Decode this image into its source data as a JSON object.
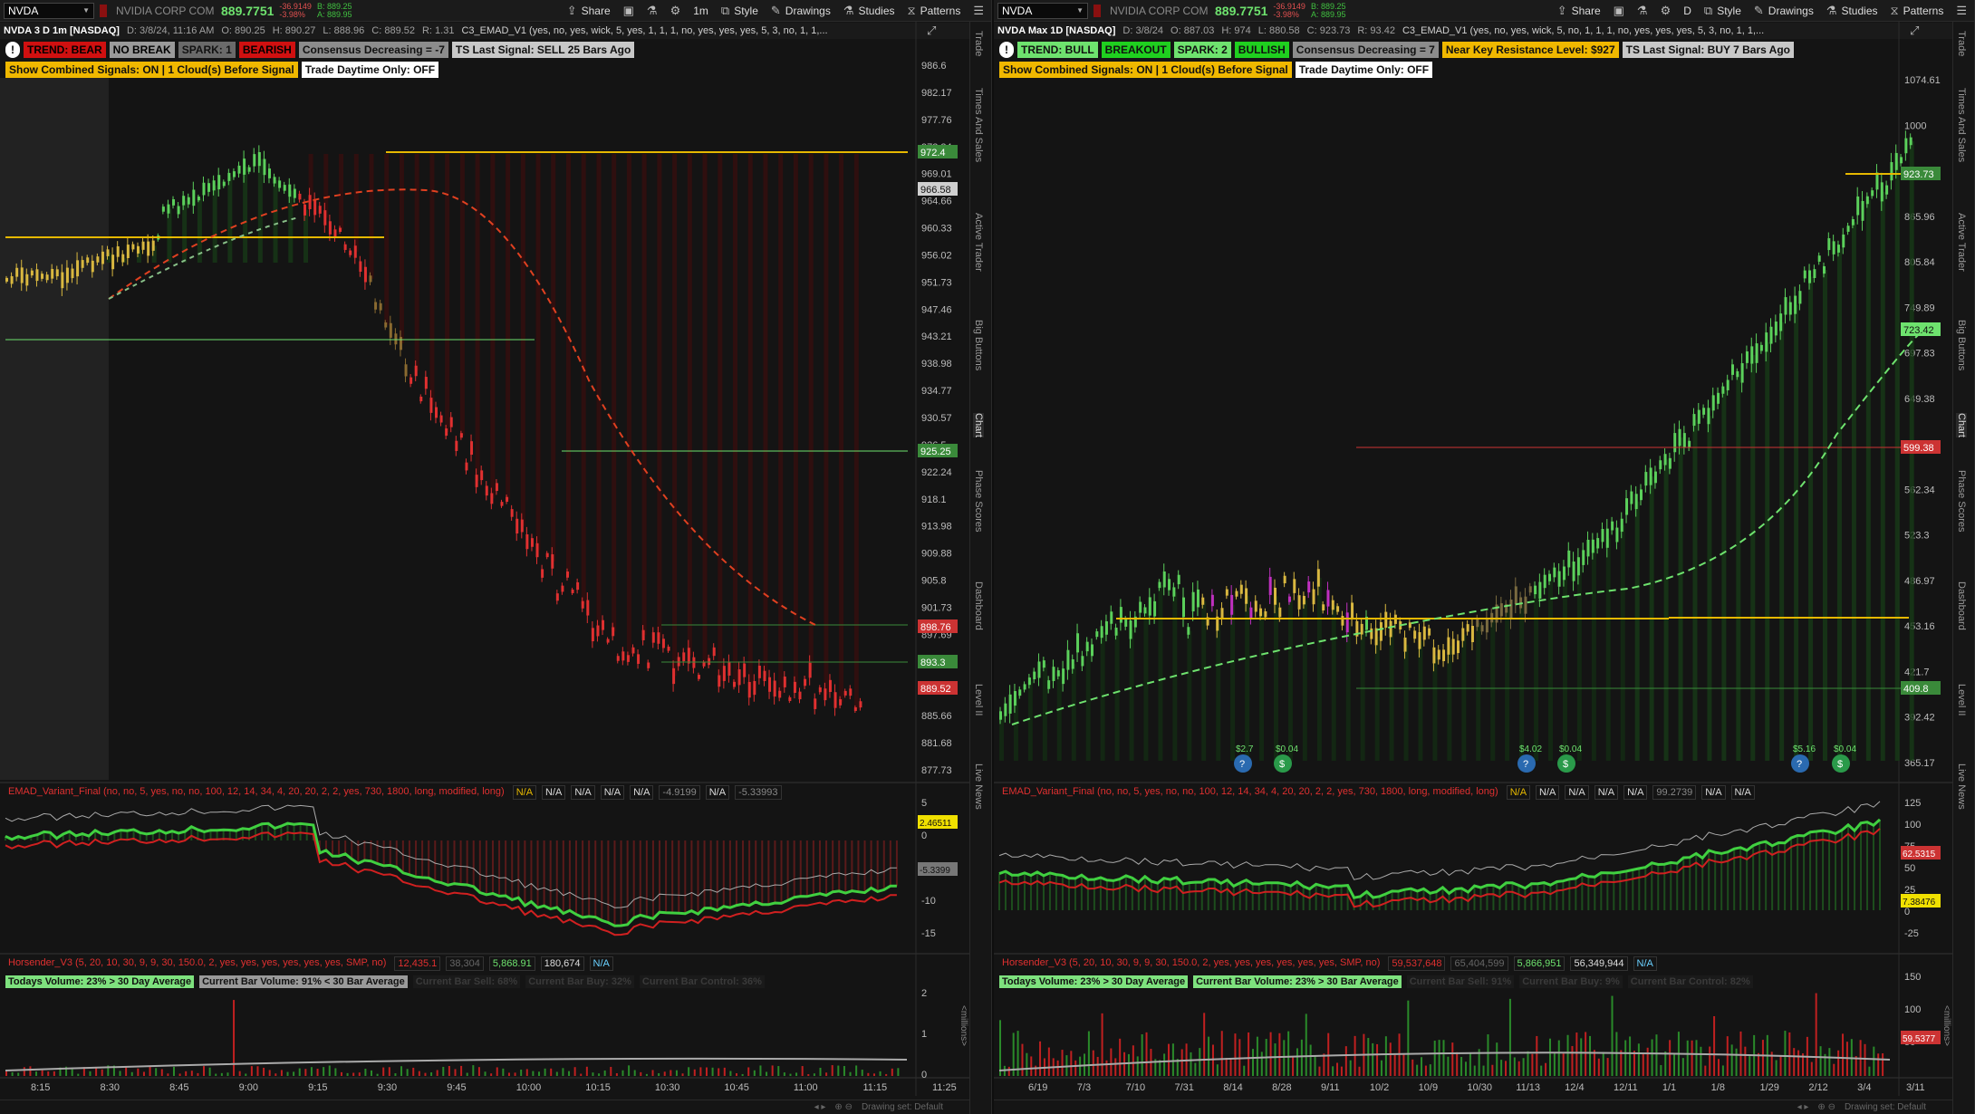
{
  "left": {
    "symbol": "NVDA",
    "company": "NVIDIA CORP COM",
    "price": "889.7751",
    "change_top": "-36.9149",
    "change_pct": "-3.98%",
    "bid": "B: 889.25",
    "ask": "A: 889.95",
    "toolbar": {
      "share": "Share",
      "period": "1m",
      "style": "Style",
      "drawings": "Drawings",
      "studies": "Studies",
      "patterns": "Patterns"
    },
    "header": {
      "title": "NVDA 3 D 1m [NASDAQ]",
      "date": "D: 3/8/24, 11:16 AM",
      "open": "O: 890.25",
      "high": "H: 890.27",
      "low": "L: 888.96",
      "close": "C: 889.52",
      "range": "R: 1.31",
      "study": "C3_EMAD_V1 (yes, no, yes, wick, 5, yes, 1, 1, 1, no, yes, yes, yes, 5, 3, no, 1, 1,..."
    },
    "labels": [
      {
        "text": "TREND: BEAR",
        "bg": "#d01010",
        "fg": "#000000"
      },
      {
        "text": "NO BREAK",
        "bg": "#9a9a9a",
        "fg": "#000000"
      },
      {
        "text": "SPARK: 1",
        "bg": "#6a6a6a",
        "fg": "#111111"
      },
      {
        "text": "BEARISH",
        "bg": "#d01010",
        "fg": "#000000"
      },
      {
        "text": "Consensus Decreasing = -7",
        "bg": "#8c8c8c",
        "fg": "#111111"
      },
      {
        "text": "TS Last Signal: SELL 25 Bars Ago",
        "bg": "#c8c8c8",
        "fg": "#111111"
      },
      {
        "text": "Show Combined Signals: ON | 1 Cloud(s) Before Signal",
        "bg": "#f0b800",
        "fg": "#111111"
      },
      {
        "text": "Trade Daytime Only: OFF",
        "bg": "#ffffff",
        "fg": "#111111"
      }
    ],
    "price_axis": [
      "986.6",
      "982.17",
      "977.76",
      "973.34",
      "969.01",
      "964.66",
      "960.33",
      "956.02",
      "951.73",
      "947.46",
      "943.21",
      "938.98",
      "934.77",
      "930.57",
      "926.5",
      "922.24",
      "918.1",
      "913.98",
      "909.88",
      "905.8",
      "901.73",
      "897.69",
      "893.3",
      "889.66",
      "885.66",
      "881.68",
      "877.73"
    ],
    "price_tags": [
      {
        "text": "972.4",
        "bg": "#3a8a3a"
      },
      {
        "text": "966.58",
        "bg": "#cfcfcf"
      },
      {
        "text": "925.25",
        "bg": "#3a8a3a"
      },
      {
        "text": "898.76",
        "bg": "#c33"
      },
      {
        "text": "893.3",
        "bg": "#3a8a3a"
      },
      {
        "text": "889.52",
        "bg": "#c33"
      }
    ],
    "ind1": {
      "name": "EMAD_Variant_Final (no, no, 5, yes, no, no, 100, 12, 14, 34, 4, 20, 20, 2, 2, yes, 730, 1800, long, modified, long)",
      "vals": [
        "N/A",
        "N/A",
        "N/A",
        "N/A",
        "N/A",
        "-4.9199",
        "N/A",
        "-5.33993"
      ],
      "axis": [
        "5",
        "0",
        "-5",
        "-10",
        "-15"
      ],
      "tag1": "2.46511",
      "tag2": "-5.3399"
    },
    "ind2": {
      "name": "Horsender_V3 (5, 20, 10, 30, 9, 9, 30, 150.0, 2, yes, yes, yes, yes, yes, yes, SMP, no)",
      "vals": [
        "12,435.1",
        "38,304",
        "5,868.91",
        "180,674",
        "N/A"
      ],
      "axis": [
        "2",
        "1",
        "0"
      ],
      "unit": "<millions>"
    },
    "vol_labels": [
      "Todays Volume: 23% > 30 Day Average",
      "Current Bar Volume: 91% < 30 Bar Average",
      "Current Bar Sell: 68%",
      "Current Bar Buy: 32%",
      "Current Bar Control: 36%"
    ],
    "time_axis": [
      "8:15",
      "8:30",
      "8:45",
      "9:00",
      "9:15",
      "9:30",
      "9:45",
      "10:00",
      "10:15",
      "10:30",
      "10:45",
      "11:00",
      "11:15",
      "11:25"
    ],
    "sidebar": [
      "Trade",
      "Times And Sales",
      "Active Trader",
      "Big Buttons",
      "Chart",
      "Phase Scores",
      "Dashboard",
      "Level II",
      "Live News"
    ],
    "drawing_set": "Drawing set: Default"
  },
  "right": {
    "symbol": "NVDA",
    "company": "NVIDIA CORP COM",
    "price": "889.7751",
    "change_top": "-36.9149",
    "change_pct": "-3.98%",
    "bid": "B: 889.25",
    "ask": "A: 889.95",
    "toolbar": {
      "share": "Share",
      "period": "D",
      "style": "Style",
      "drawings": "Drawings",
      "studies": "Studies",
      "patterns": "Patterns"
    },
    "header": {
      "title": "NVDA Max 1D [NASDAQ]",
      "date": "D: 3/8/24",
      "open": "O: 887.03",
      "high": "H: 974",
      "low": "L: 880.58",
      "close": "C: 923.73",
      "range": "R: 93.42",
      "study": "C3_EMAD_V1 (yes, no, yes, wick, 5, no, 1, 1, 1, no, yes, yes, yes, 5, 3, no, 1, 1,..."
    },
    "labels": [
      {
        "text": "TREND: BULL",
        "bg": "#6ee26e",
        "fg": "#111111"
      },
      {
        "text": "BREAKOUT",
        "bg": "#1fd01f",
        "fg": "#111111"
      },
      {
        "text": "SPARK: 2",
        "bg": "#6ee26e",
        "fg": "#111111"
      },
      {
        "text": "BULLISH",
        "bg": "#1fd01f",
        "fg": "#111111"
      },
      {
        "text": "Consensus Decreasing = 7",
        "bg": "#8c8c8c",
        "fg": "#111111"
      },
      {
        "text": "Near Key Resistance Level: $927",
        "bg": "#f0b800",
        "fg": "#111111"
      },
      {
        "text": "TS Last Signal: BUY 7 Bars Ago",
        "bg": "#c8c8c8",
        "fg": "#111111"
      },
      {
        "text": "Show Combined Signals: ON | 1 Cloud(s) Before Signal",
        "bg": "#f0b800",
        "fg": "#111111"
      },
      {
        "text": "Trade Daytime Only: OFF",
        "bg": "#ffffff",
        "fg": "#111111"
      }
    ],
    "price_axis": [
      "1074.61",
      "1000",
      "923.73",
      "865.96",
      "805.84",
      "749.89",
      "697.83",
      "649.38",
      "599.38",
      "562.34",
      "523.3",
      "486.97",
      "453.16",
      "421.7",
      "392.42",
      "365.17"
    ],
    "price_tags": [
      {
        "text": "923.73",
        "bg": "#3a8a3a"
      },
      {
        "text": "723.42",
        "bg": "#6ee26e"
      },
      {
        "text": "599.38",
        "bg": "#c33"
      },
      {
        "text": "409.8",
        "bg": "#3a8a3a"
      }
    ],
    "events": [
      {
        "top": "$2.7",
        "icon": "bulb"
      },
      {
        "top": "$0.04",
        "icon": "dollar"
      },
      {
        "top": "$4.02",
        "icon": "bulb"
      },
      {
        "top": "$0.04",
        "icon": "dollar"
      },
      {
        "top": "$5.16",
        "icon": "bulb"
      },
      {
        "top": "$0.04",
        "icon": "dollar"
      }
    ],
    "ind1": {
      "name": "EMAD_Variant_Final (no, no, 5, yes, no, no, 100, 12, 14, 34, 4, 20, 20, 2, 2, yes, 730, 1800, long, modified, long)",
      "vals": [
        "N/A",
        "N/A",
        "N/A",
        "N/A",
        "N/A",
        "99.2739",
        "N/A",
        "N/A"
      ],
      "axis": [
        "125",
        "100",
        "75",
        "50",
        "25",
        "0",
        "-25"
      ],
      "tag1": "62.5315",
      "tag2": "7.38476"
    },
    "ind2": {
      "name": "Horsender_V3 (5, 20, 10, 30, 9, 9, 30, 150.0, 2, yes, yes, yes, yes, yes, yes, SMP, no)",
      "vals": [
        "59,537,648",
        "65,404,599",
        "5,866,951",
        "56,349,944",
        "N/A"
      ],
      "axis": [
        "150",
        "100",
        "50"
      ],
      "tag": "59.5377",
      "unit": "<millions>"
    },
    "vol_labels": [
      "Todays Volume: 23% > 30 Day Average",
      "Current Bar Volume: 23% > 30 Bar Average",
      "Current Bar Sell: 91%",
      "Current Bar Buy: 9%",
      "Current Bar Control: 82%"
    ],
    "time_axis": [
      "6/19",
      "7/3",
      "7/10",
      "7/31",
      "8/14",
      "8/28",
      "9/11",
      "10/2",
      "10/9",
      "10/30",
      "11/13",
      "12/4",
      "12/11",
      "1/1",
      "1/8",
      "1/29",
      "2/12",
      "3/4",
      "3/11"
    ],
    "sidebar": [
      "Trade",
      "Times And Sales",
      "Active Trader",
      "Big Buttons",
      "Chart",
      "Phase Scores",
      "Dashboard",
      "Level II",
      "Live News"
    ],
    "drawing_set": "Drawing set: Default"
  }
}
